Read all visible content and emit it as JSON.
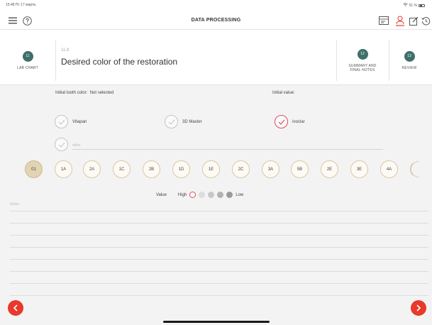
{
  "status_bar": {
    "time_carrier": "15:48  Пт 17 марта",
    "battery": "51 %"
  },
  "navbar": {
    "title": "DATA PROCESSING",
    "icons": [
      "menu-icon",
      "help-icon",
      "chart-icon",
      "patient-icon",
      "edit-icon",
      "history-icon"
    ],
    "accent": "#e8392b"
  },
  "stepper": {
    "prev": {
      "number": "11",
      "label": "LAB CHART"
    },
    "current": {
      "number": "11.8",
      "title": "Desired color of the restoration"
    },
    "next": {
      "number": "12",
      "label_line1": "SUMMARY AND",
      "label_line2": "FINAL NOTES"
    },
    "last": {
      "number": "13",
      "label": "REVIEW"
    },
    "circle_color": "#3f6f69"
  },
  "initial": {
    "tooth_color_label": "Initial tooth color:",
    "tooth_color_value": "Not selected",
    "initial_value_label": "Initial value:",
    "initial_value": ""
  },
  "systems": [
    {
      "label": "Vitapan",
      "selected": false
    },
    {
      "label": "3D Master",
      "selected": false
    },
    {
      "label": "Ivoclar",
      "selected": true
    }
  ],
  "other": {
    "placeholder": "other"
  },
  "shades": [
    "01",
    "1A",
    "2A",
    "1C",
    "2B",
    "1D",
    "1E",
    "2C",
    "3A",
    "5B",
    "2E",
    "3E",
    "4A"
  ],
  "selected_shade": "01",
  "value_scale": {
    "label": "Value",
    "high": "High",
    "low": "Low",
    "levels": 5,
    "selected_level": 1,
    "dot_colors": [
      "#ffffff",
      "#dcdcdc",
      "#c8c8c8",
      "#b2b2b2",
      "#9a9a9a"
    ]
  },
  "notes": {
    "placeholder": "Notes"
  }
}
